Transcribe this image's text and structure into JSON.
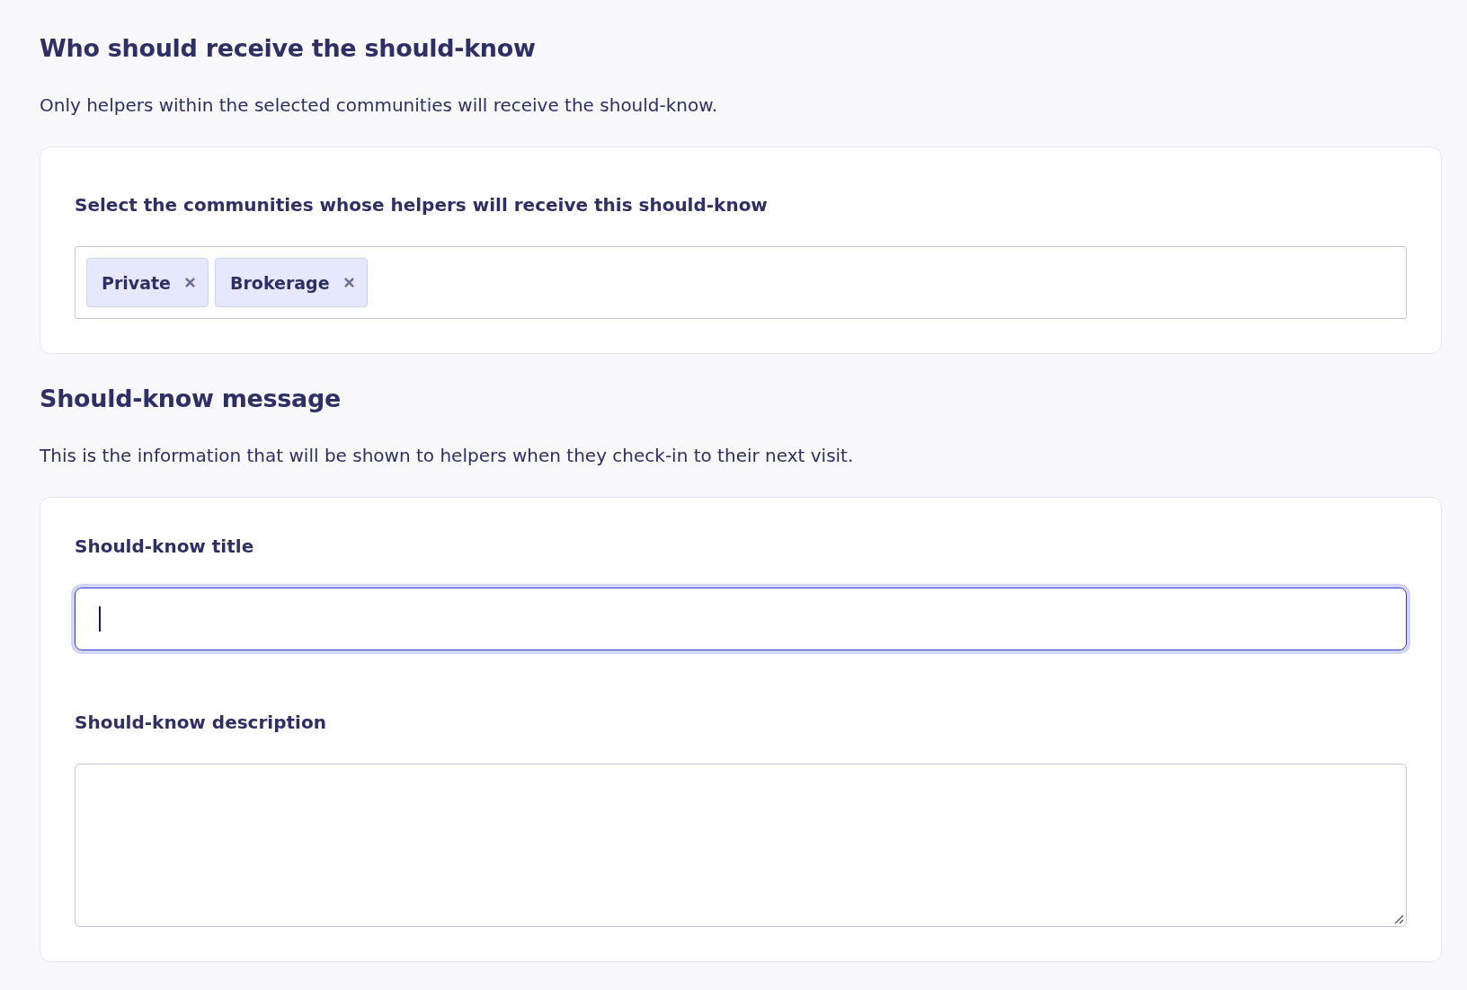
{
  "recipients": {
    "heading": "Who should receive the should-know",
    "description": "Only helpers within the selected communities will receive the should-know.",
    "field_label": "Select the communities whose helpers will receive this should-know",
    "tags": [
      {
        "label": "Private"
      },
      {
        "label": "Brokerage"
      }
    ]
  },
  "message": {
    "heading": "Should-know message",
    "description": "This is the information that will be shown to helpers when they check-in to their next visit.",
    "fields": [
      {
        "kind": "input",
        "label": "Should-know title",
        "focused": true
      },
      {
        "kind": "textarea",
        "label": "Should-know description",
        "focused": false
      }
    ]
  }
}
